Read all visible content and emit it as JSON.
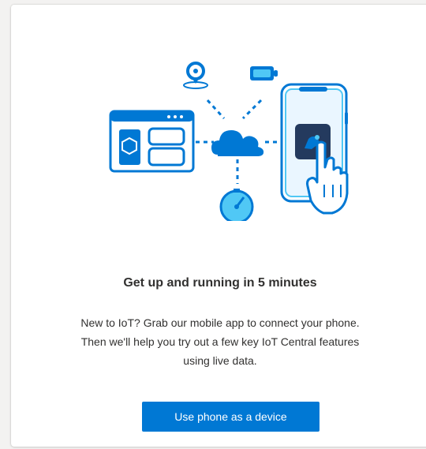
{
  "card": {
    "title": "Get up and running in 5 minutes",
    "description_lines": [
      "New to IoT? Grab our mobile app to connect your phone.",
      "Then we'll help you try out a few key IoT Central features",
      "using live data."
    ],
    "button_label": "Use phone as a device"
  },
  "illustration": {
    "icons": [
      "location-pin-icon",
      "battery-icon",
      "dashboard-window-icon",
      "cloud-icon",
      "gauge-icon",
      "phone-icon",
      "hand-pointer-icon"
    ],
    "colors": {
      "primary": "#0078d4",
      "light": "#50c8f5",
      "dark": "#243a5e",
      "accent_bg": "#0078d4",
      "text": "#323130"
    }
  }
}
